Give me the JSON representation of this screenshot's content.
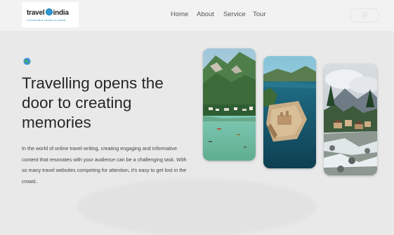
{
  "brand": {
    "name_left": "travel",
    "name_right": "india",
    "tagline": "SUSTAINABLE TRAVEL PLANNER",
    "globe_icon": "globe-icon"
  },
  "nav": {
    "items": [
      {
        "label": "Home"
      },
      {
        "label": "About"
      },
      {
        "label": "Service"
      },
      {
        "label": "Tour"
      }
    ]
  },
  "hero": {
    "icon": "globe-emoji-icon",
    "title": "Travelling opens the door to creating memories",
    "description": "In the world of online travel writing, creating engaging and informative content that resonates with your audience can be a challenging task. With so many travel websites competing for attention, it's easy to get lost in the crowd.."
  },
  "gallery": {
    "cards": [
      {
        "name": "river-town-photo",
        "subject": "river valley town"
      },
      {
        "name": "lake-fort-photo",
        "subject": "lake fort"
      },
      {
        "name": "mountain-village-photo",
        "subject": "mountain village"
      }
    ]
  },
  "colors": {
    "background": "#e9e9ea",
    "header": "#f2f2f3",
    "brand_blue": "#0a7ab7",
    "text_dark": "#262626"
  }
}
